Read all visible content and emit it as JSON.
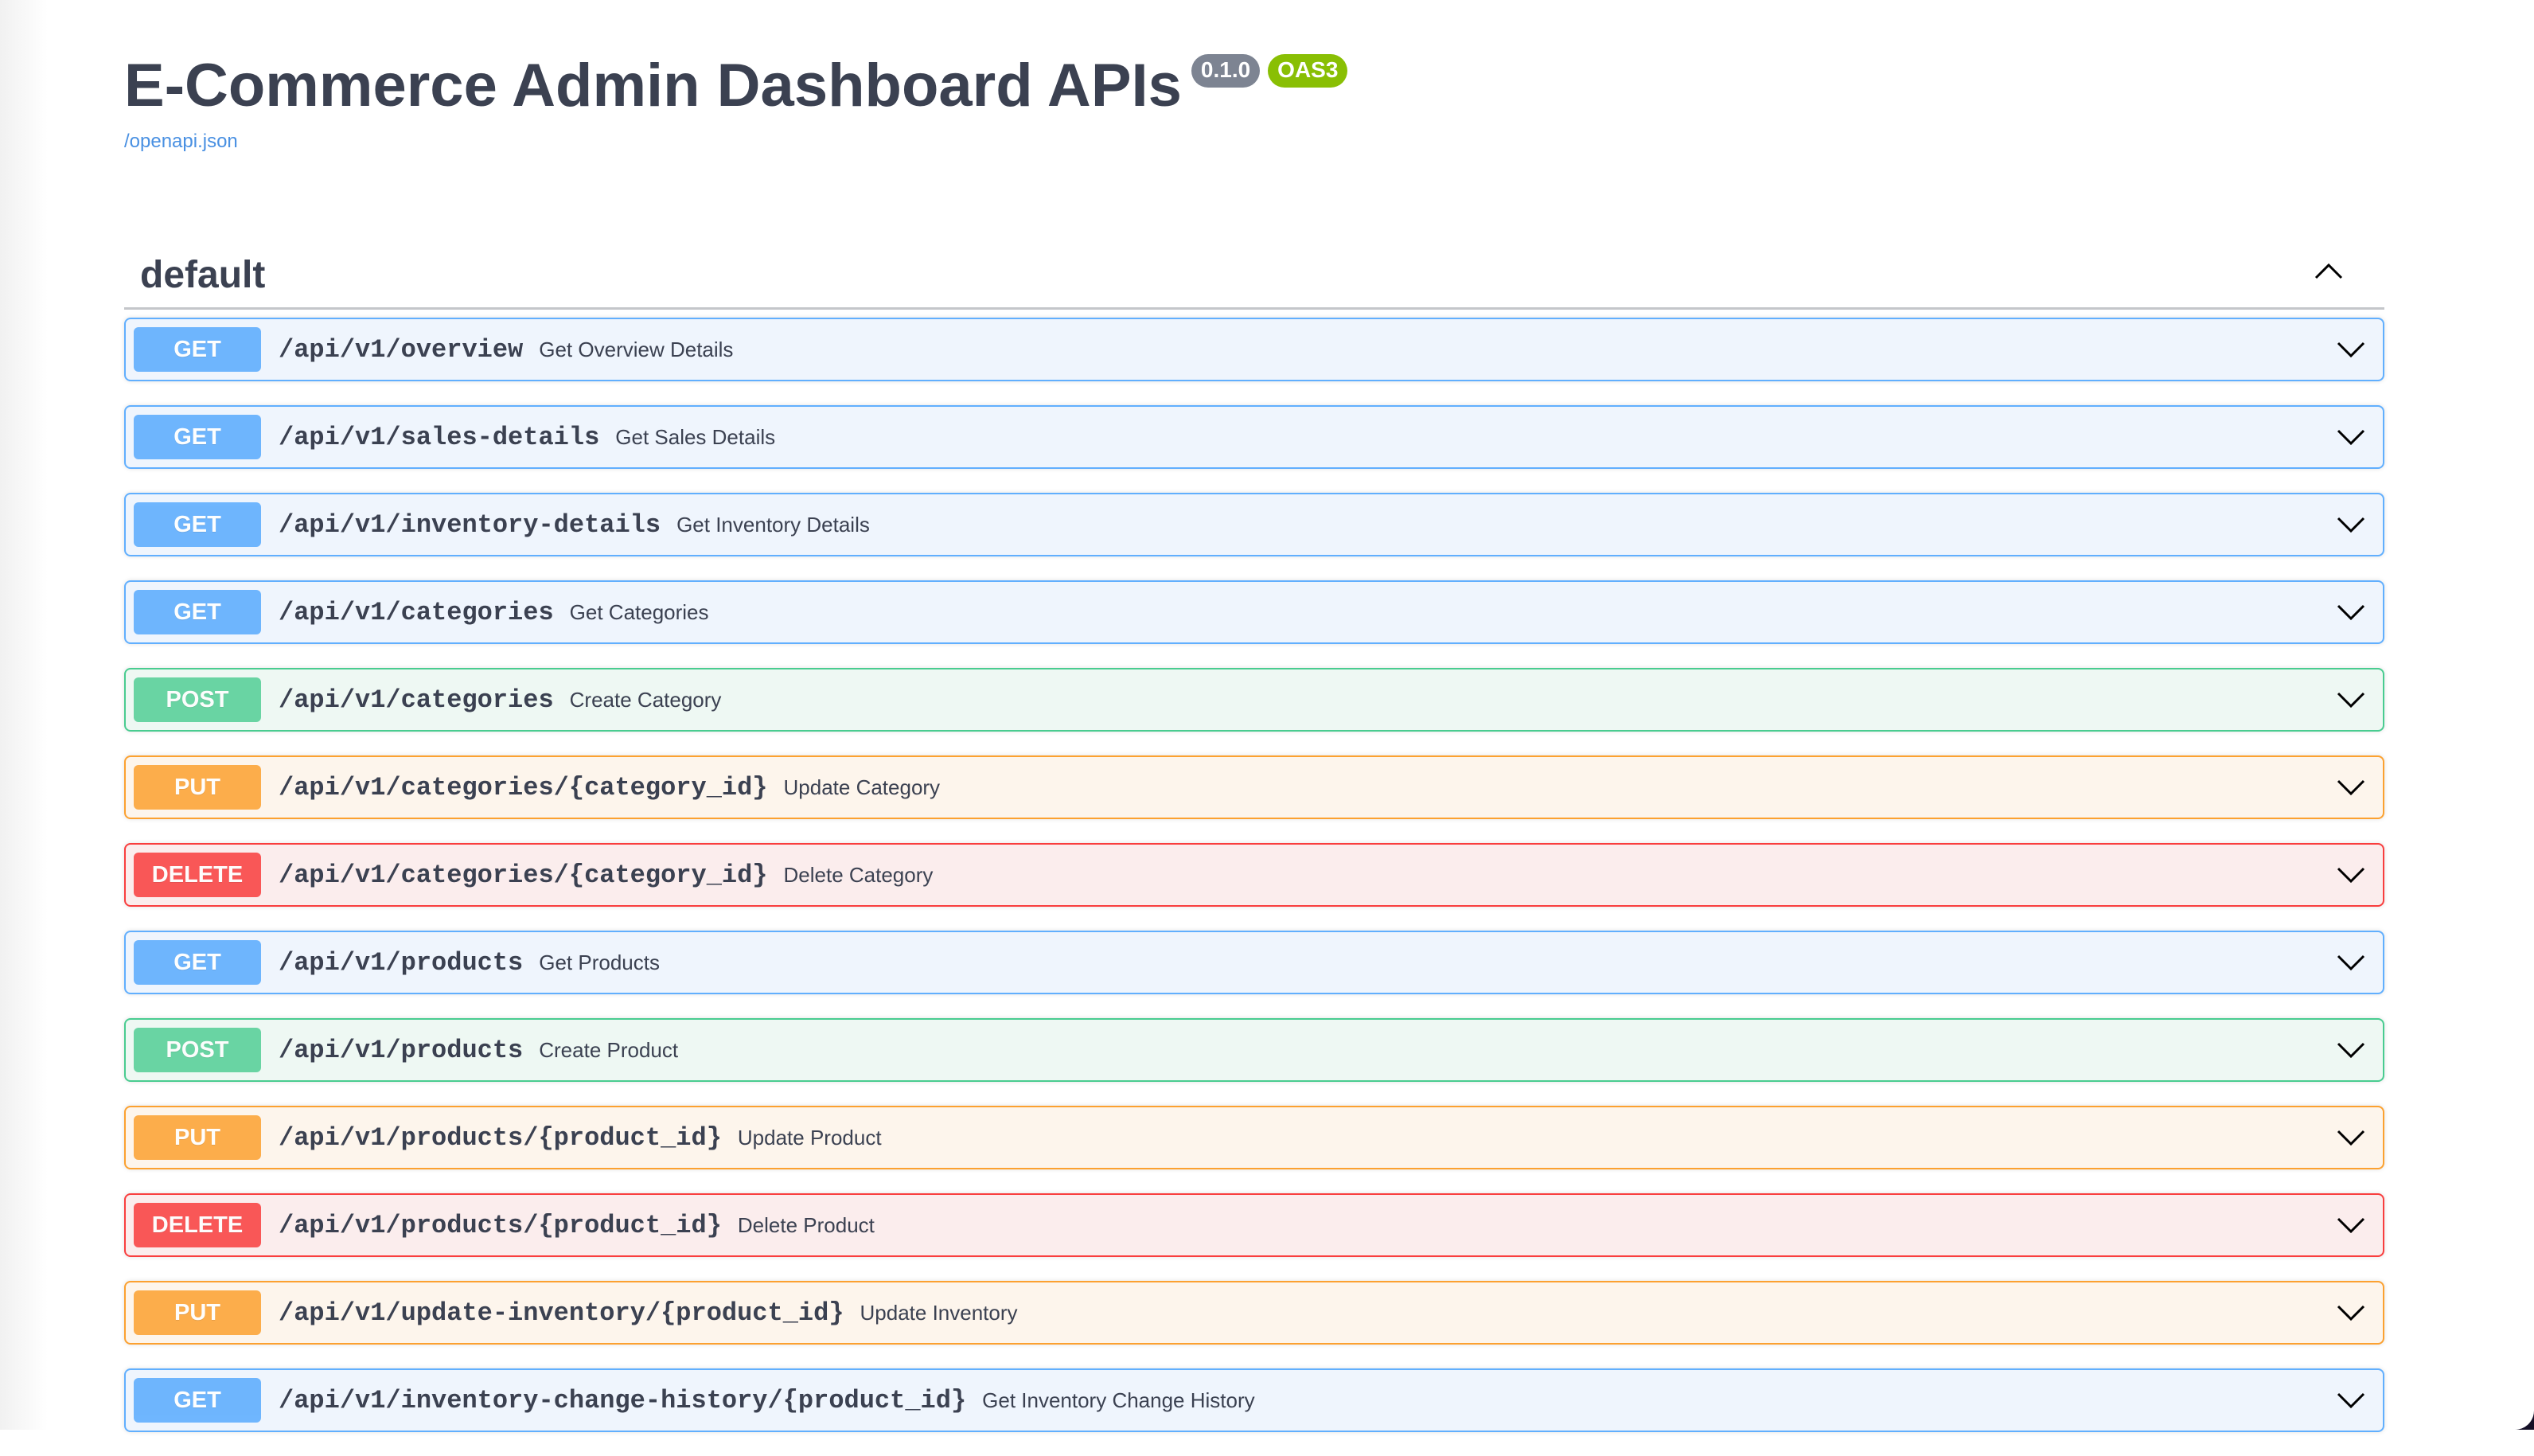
{
  "header": {
    "title": "E-Commerce Admin Dashboard APIs",
    "version_badge": "0.1.0",
    "oas_badge": "OAS3",
    "spec_link": "/openapi.json"
  },
  "colors": {
    "get": "#61affe",
    "post": "#49cc90",
    "put": "#fca130",
    "delete": "#f93e3e",
    "version_badge": "#7d8492",
    "oas_badge": "#89bf04",
    "link": "#4990e2"
  },
  "section": {
    "name": "default",
    "expanded": true,
    "toggle_icon": "chevron-up-icon"
  },
  "operations": [
    {
      "method": "GET",
      "path": "/api/v1/overview",
      "summary": "Get Overview Details"
    },
    {
      "method": "GET",
      "path": "/api/v1/sales-details",
      "summary": "Get Sales Details"
    },
    {
      "method": "GET",
      "path": "/api/v1/inventory-details",
      "summary": "Get Inventory Details"
    },
    {
      "method": "GET",
      "path": "/api/v1/categories",
      "summary": "Get Categories"
    },
    {
      "method": "POST",
      "path": "/api/v1/categories",
      "summary": "Create Category"
    },
    {
      "method": "PUT",
      "path": "/api/v1/categories/{category_id}",
      "summary": "Update Category"
    },
    {
      "method": "DELETE",
      "path": "/api/v1/categories/{category_id}",
      "summary": "Delete Category"
    },
    {
      "method": "GET",
      "path": "/api/v1/products",
      "summary": "Get Products"
    },
    {
      "method": "POST",
      "path": "/api/v1/products",
      "summary": "Create Product"
    },
    {
      "method": "PUT",
      "path": "/api/v1/products/{product_id}",
      "summary": "Update Product"
    },
    {
      "method": "DELETE",
      "path": "/api/v1/products/{product_id}",
      "summary": "Delete Product"
    },
    {
      "method": "PUT",
      "path": "/api/v1/update-inventory/{product_id}",
      "summary": "Update Inventory"
    },
    {
      "method": "GET",
      "path": "/api/v1/inventory-change-history/{product_id}",
      "summary": "Get Inventory Change History"
    }
  ]
}
